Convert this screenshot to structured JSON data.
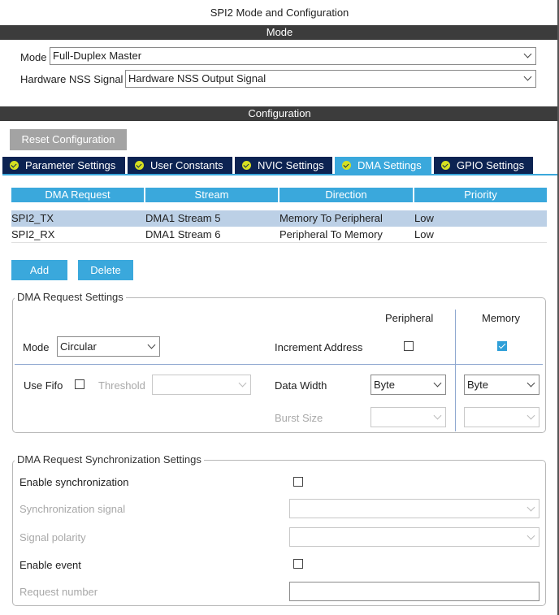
{
  "window_title": "SPI2 Mode and Configuration",
  "mode_section": {
    "header": "Mode",
    "mode_label": "Mode",
    "mode_value": "Full-Duplex Master",
    "nss_label": "Hardware NSS Signal",
    "nss_value": "Hardware NSS Output Signal"
  },
  "config_section": {
    "header": "Configuration",
    "reset_label": "Reset Configuration",
    "tabs": [
      {
        "label": "Parameter Settings"
      },
      {
        "label": "User Constants"
      },
      {
        "label": "NVIC Settings"
      },
      {
        "label": "DMA Settings",
        "active": true
      },
      {
        "label": "GPIO Settings"
      }
    ]
  },
  "dma_table": {
    "columns": [
      "DMA Request",
      "Stream",
      "Direction",
      "Priority"
    ],
    "rows": [
      [
        "SPI2_TX",
        "DMA1 Stream 5",
        "Memory To Peripheral",
        "Low"
      ],
      [
        "SPI2_RX",
        "DMA1 Stream 6",
        "Peripheral To Memory",
        "Low"
      ]
    ],
    "selected_row": 0,
    "add_label": "Add",
    "delete_label": "Delete"
  },
  "request_settings": {
    "title": "DMA Request Settings",
    "peripheral_header": "Peripheral",
    "memory_header": "Memory",
    "mode_label": "Mode",
    "mode_value": "Circular",
    "increment_label": "Increment Address",
    "peripheral_increment": false,
    "memory_increment": true,
    "use_fifo_label": "Use Fifo",
    "use_fifo": false,
    "threshold_label": "Threshold",
    "threshold_value": "",
    "data_width_label": "Data Width",
    "peripheral_data_width": "Byte",
    "memory_data_width": "Byte",
    "burst_size_label": "Burst Size"
  },
  "sync_settings": {
    "title": "DMA Request Synchronization Settings",
    "enable_sync_label": "Enable synchronization",
    "sync_signal_label": "Synchronization signal",
    "signal_polarity_label": "Signal polarity",
    "enable_event_label": "Enable event",
    "request_number_label": "Request number"
  },
  "colors": {
    "accent": "#3aa8dc",
    "tab_bg": "#0c2352",
    "selected_row": "#bcd0e6",
    "header_bar": "#3c3c3c"
  }
}
